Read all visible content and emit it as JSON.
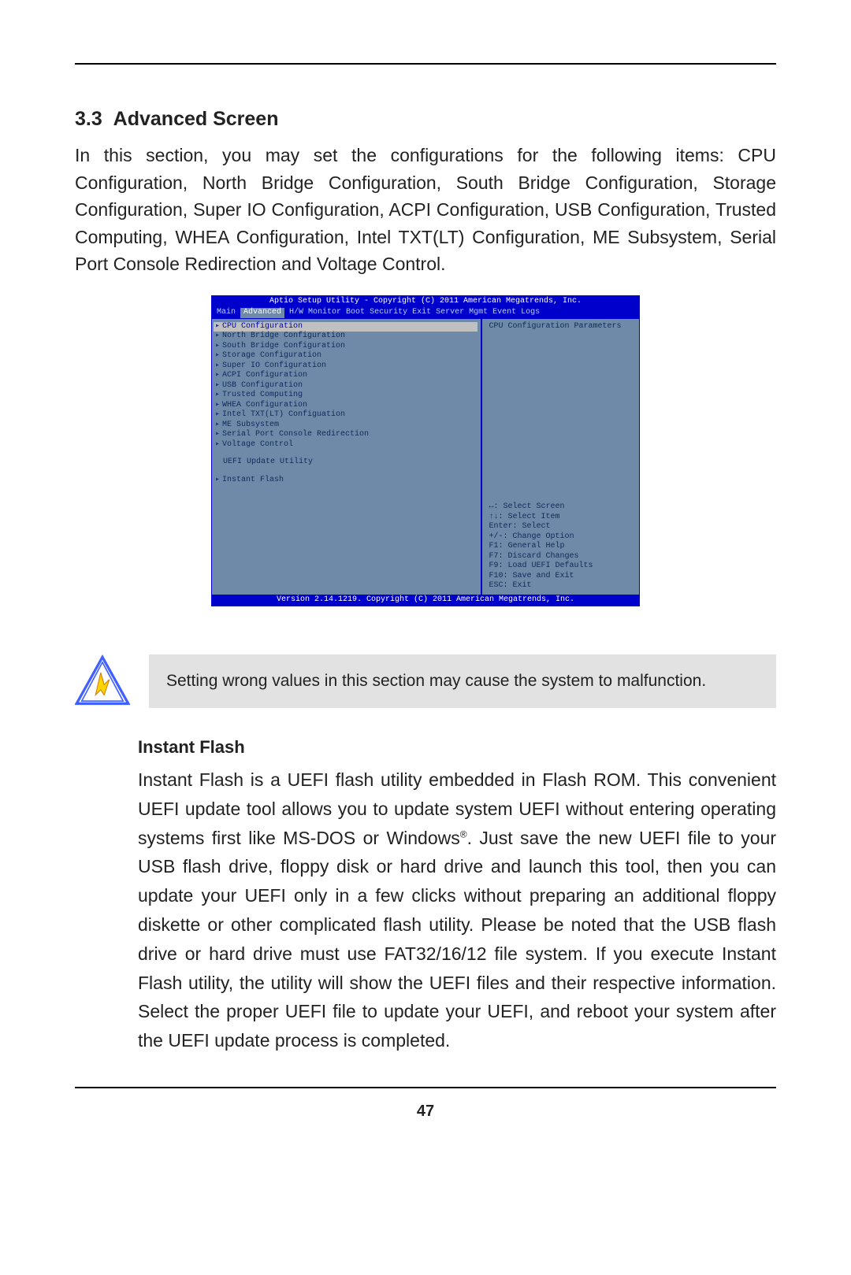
{
  "section": {
    "number": "3.3",
    "title": "Advanced Screen",
    "intro": "In this section, you may set the configurations for the following items: CPU Configuration, North Bridge Configuration, South Bridge Configuration, Storage Configuration, Super IO Configuration, ACPI Configuration, USB Configuration, Trusted Computing, WHEA Configuration, Intel TXT(LT) Configuration, ME Subsystem, Serial Port Console Redirection and Voltage Control."
  },
  "bios": {
    "header": "Aptio Setup Utility - Copyright (C) 2011 American Megatrends, Inc.",
    "tabs": [
      "Main",
      "Advanced",
      "H/W Monitor",
      "Boot",
      "Security",
      "Exit",
      "Server Mgmt",
      "Event Logs"
    ],
    "active_tab": "Advanced",
    "menu": [
      "CPU Configuration",
      "North Bridge Configuration",
      "South Bridge Configuration",
      "Storage Configuration",
      "Super IO Configuration",
      "ACPI Configuration",
      "USB Configuration",
      "Trusted Computing",
      "WHEA Configuration",
      "Intel TXT(LT) Configuation",
      "ME Subsystem",
      "Serial Port Console Redirection",
      "Voltage Control"
    ],
    "group_label": "UEFI Update Utility",
    "instant_flash": "Instant Flash",
    "help_top": "CPU Configuration Parameters",
    "help_keys": [
      "↔: Select Screen",
      "↑↓: Select Item",
      "Enter: Select",
      "+/-: Change Option",
      "F1: General Help",
      "F7: Discard Changes",
      "F9: Load UEFI Defaults",
      "F10: Save and Exit",
      "ESC: Exit"
    ],
    "footer": "Version 2.14.1219. Copyright (C) 2011 American Megatrends, Inc."
  },
  "warning": {
    "text": "Setting wrong values in this section may cause  the system to malfunction."
  },
  "subsection": {
    "title": "Instant Flash",
    "body_pre": "Instant Flash is a UEFI flash utility embedded in Flash ROM. This convenient UEFI update tool allows you to update system UEFI without entering operating systems first like MS-DOS or Windows",
    "reg": "®",
    "body_post": ". Just save the new UEFI file to your USB flash drive, floppy disk or hard drive and launch this tool, then you can update your UEFI only in a few clicks without preparing an additional floppy diskette or other complicated flash utility. Please be noted that the USB flash drive or hard drive must use FAT32/16/12 file system. If you execute Instant Flash utility, the utility will show the UEFI files and their respective information. Select the proper UEFI file to update your UEFI, and reboot your system after the UEFI update process is completed."
  },
  "page_number": "47"
}
